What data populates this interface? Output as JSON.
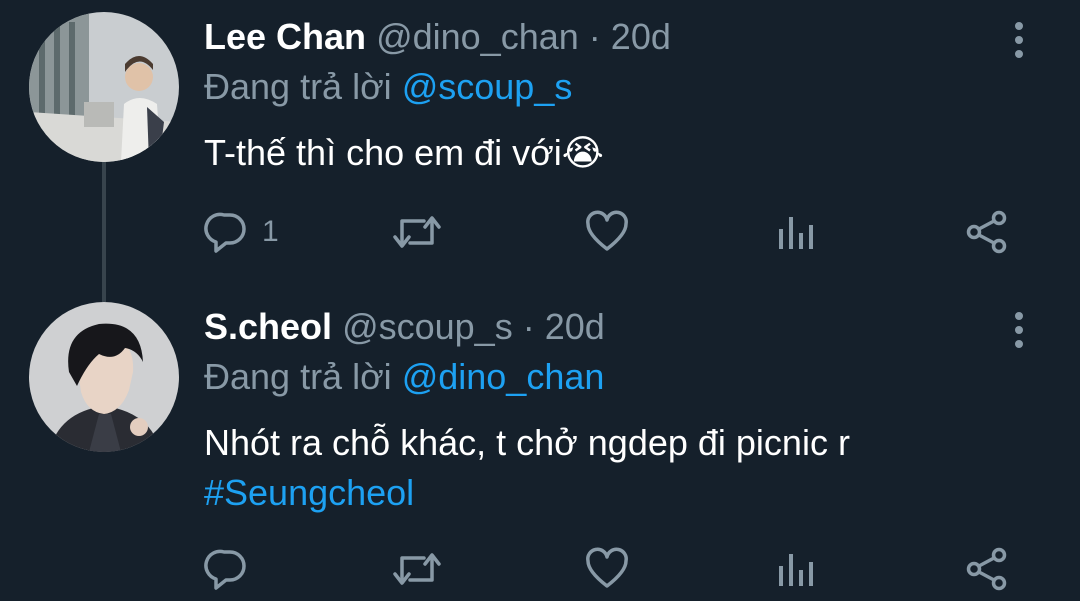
{
  "tweets": [
    {
      "name": "Lee Chan",
      "handle": "@dino_chan",
      "separator": "·",
      "time": "20d",
      "reply_prefix": "Đang trả lời",
      "reply_to": "@scoup_s",
      "text": "T-thế thì cho em đi với",
      "emoji": "😭",
      "reply_count": "1",
      "icons": [
        "reply-icon",
        "retweet-icon",
        "like-icon",
        "analytics-icon",
        "share-icon",
        "more-icon"
      ]
    },
    {
      "name": "S.cheol",
      "handle": "@scoup_s",
      "separator": "·",
      "time": "20d",
      "reply_prefix": "Đang trả lời",
      "reply_to": "@dino_chan",
      "text": "Nhót ra chỗ khác, t chở ngdep đi picnic r",
      "hashtag": "#Seungcheol",
      "reply_count": "",
      "icons": [
        "reply-icon",
        "retweet-icon",
        "like-icon",
        "analytics-icon",
        "share-icon",
        "more-icon"
      ]
    }
  ],
  "colors": {
    "background": "#15202b",
    "text_primary": "#ffffff",
    "text_secondary": "#8899a6",
    "accent": "#1da1f2",
    "thread_line": "#38444d"
  }
}
